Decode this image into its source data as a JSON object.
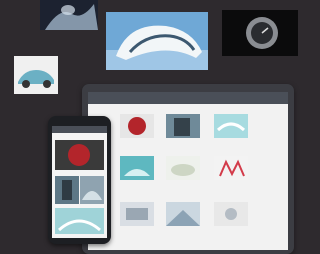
{
  "laptop_app": {
    "title": "",
    "sections": [
      {
        "label": ""
      },
      {
        "label": ""
      },
      {
        "label": ""
      }
    ]
  },
  "phone_app": {
    "title": "",
    "section_label": ""
  },
  "photos": [
    {
      "icon": "dancer-photo"
    },
    {
      "icon": "futuristic-building-photo"
    },
    {
      "icon": "wristwatch-photo"
    },
    {
      "icon": "concept-car-photo"
    }
  ],
  "colors": {
    "background": "#2e2a2e",
    "device": "#3c3d43",
    "appbar": "#4a4f58"
  }
}
